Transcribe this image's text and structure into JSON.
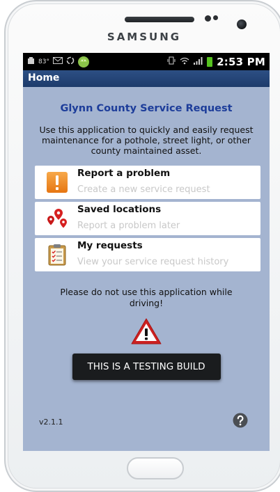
{
  "device": {
    "brand": "SAMSUNG"
  },
  "status_bar": {
    "time": "2:53 PM",
    "temperature": "83°"
  },
  "titlebar": {
    "title": "Home"
  },
  "app": {
    "title": "Glynn County Service Request",
    "intro": "Use this application to quickly and easily request maintenance for a pothole, street light, or other county maintained asset."
  },
  "menu": [
    {
      "title": "Report a problem",
      "subtitle": "Create a new service request",
      "icon": "exclamation-icon"
    },
    {
      "title": "Saved locations",
      "subtitle": "Report a problem later",
      "icon": "map-pins-icon"
    },
    {
      "title": "My requests",
      "subtitle": "View your service request history",
      "icon": "clipboard-icon"
    }
  ],
  "warning": {
    "text": "Please do not use this application while driving!",
    "icon": "warning-triangle-icon"
  },
  "build_button": {
    "label": "THIS IS A TESTING BUILD"
  },
  "footer": {
    "version": "v2.1.1",
    "help_icon": "help-icon"
  },
  "colors": {
    "screen_background": "#a4b4d0",
    "titlebar": "#1d3b6b",
    "app_title": "#1d3d9a",
    "accent_orange": "#f08c1c",
    "warning_red": "#cc2020"
  }
}
